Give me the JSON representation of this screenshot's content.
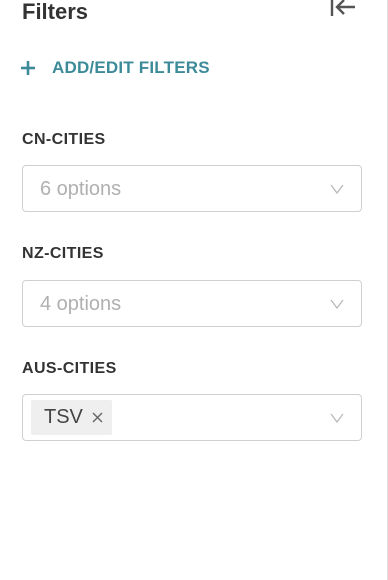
{
  "panel": {
    "title": "Filters",
    "collapse_icon": "collapse-left-icon",
    "add_filters_label": "ADD/EDIT FILTERS",
    "add_icon": "plus-icon",
    "accent_color": "#3d8b99"
  },
  "filters": [
    {
      "label": "CN-CITIES",
      "placeholder": "6 options",
      "selected": []
    },
    {
      "label": "NZ-CITIES",
      "placeholder": "4 options",
      "selected": []
    },
    {
      "label": "AUS-CITIES",
      "placeholder": "",
      "selected": [
        "TSV"
      ]
    }
  ]
}
